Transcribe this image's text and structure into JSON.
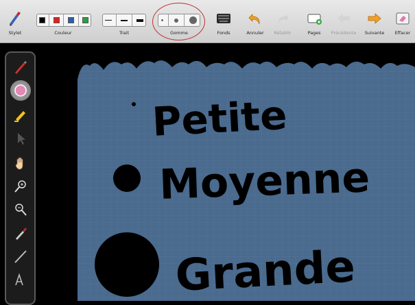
{
  "toolbar": {
    "stylet_label": "Stylet",
    "couleur_label": "Couleur",
    "trait_label": "Trait",
    "gomme_label": "Gomme",
    "fonds_label": "Fonds",
    "annuler_label": "Annuler",
    "retablir_label": "Rétablir",
    "pages_label": "Pages",
    "precedente_label": "Précédente",
    "suivante_label": "Suivante",
    "effacer_label": "Effacer",
    "colors": [
      "#000000",
      "#e02020",
      "#2d5fa8",
      "#2aa040"
    ]
  },
  "canvas": {
    "background_color": "#4a6a8e",
    "words": [
      "Petite",
      "Moyenne",
      "Grande"
    ]
  }
}
